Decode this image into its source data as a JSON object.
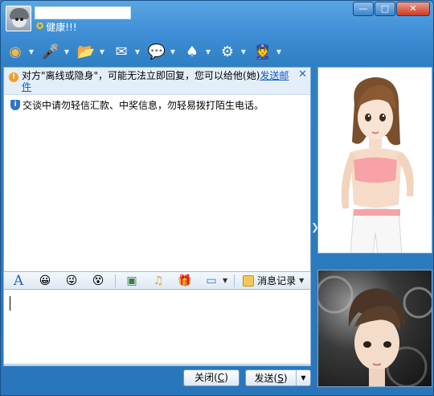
{
  "header": {
    "status_text": "健康!!!",
    "window_buttons": {
      "minimize": "—",
      "maximize": "□",
      "close": "✕"
    }
  },
  "toolbar": {
    "items": [
      {
        "icon": "video-call-icon",
        "glyph": "◉",
        "color": "#f4b64a"
      },
      {
        "icon": "voice-call-icon",
        "glyph": "🎤",
        "color": "#dfe8f5"
      },
      {
        "icon": "send-file-icon",
        "glyph": "📂",
        "color": "#f0c24c"
      },
      {
        "icon": "mail-icon",
        "glyph": "✉",
        "color": "#e7f0fa"
      },
      {
        "icon": "chat-bubble-icon",
        "glyph": "💬",
        "color": "#f4b64a"
      },
      {
        "icon": "game-icon",
        "glyph": "♠",
        "color": "#ffffff"
      },
      {
        "icon": "settings-icon",
        "glyph": "⚙",
        "color": "#cfe3f6"
      },
      {
        "icon": "user-info-icon",
        "glyph": "👮",
        "color": "#dfe8f5"
      }
    ]
  },
  "notice": {
    "text": "对方\"离线或隐身\"，可能无法立即回复，您可以给他(她)",
    "link_text": "发送邮件",
    "close": "✕"
  },
  "safety_text": "交谈中请勿轻信汇款、中奖信息，勿轻易拨打陌生电话。",
  "format_bar": {
    "font_glyph": "A",
    "items": [
      {
        "icon": "emoticon-icon",
        "glyph": "😀"
      },
      {
        "icon": "magic-emoticon-icon",
        "glyph": "😜"
      },
      {
        "icon": "shake-icon",
        "glyph": "😵"
      },
      {
        "icon": "image-icon",
        "glyph": "▣"
      },
      {
        "icon": "music-icon",
        "glyph": "♫"
      },
      {
        "icon": "gift-icon",
        "glyph": "🎁"
      },
      {
        "icon": "screen-capture-icon",
        "glyph": "▭"
      }
    ],
    "history_label": "消息记录"
  },
  "buttons": {
    "close_label": "关闭(",
    "close_key": "C",
    "send_label": "发送(",
    "send_key": "S",
    "paren": ")"
  }
}
